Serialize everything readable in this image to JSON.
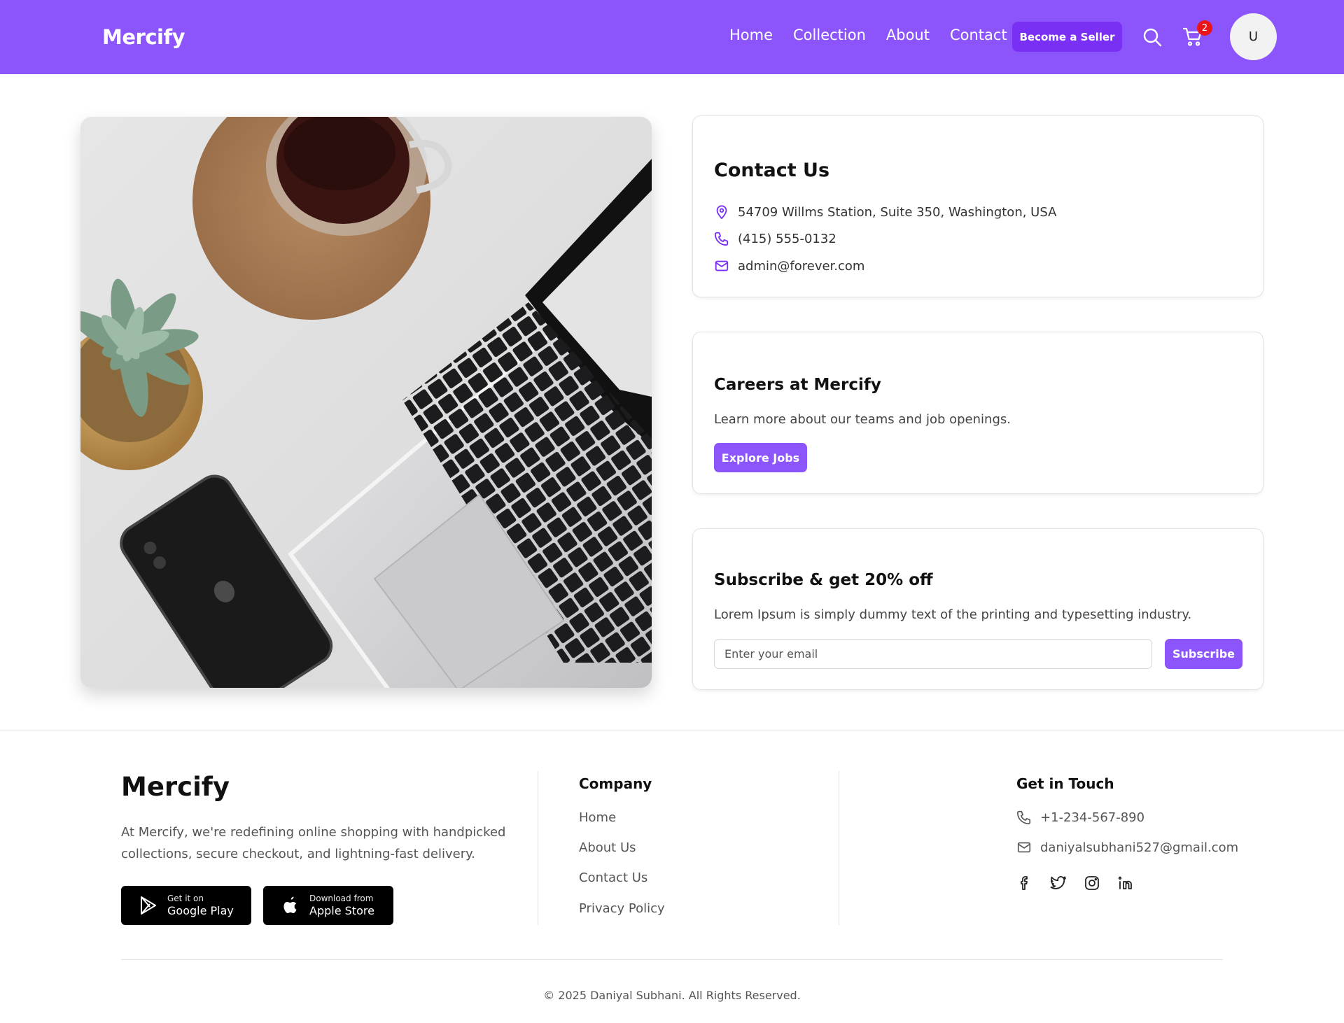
{
  "header": {
    "brand": "Mercify",
    "nav": [
      "Home",
      "Collection",
      "About",
      "Contact"
    ],
    "seller_button": "Become a Seller",
    "cart_count": "2",
    "avatar_initial": "U"
  },
  "contact": {
    "title": "Contact Us",
    "address": "54709 Willms Station, Suite 350, Washington, USA",
    "phone": "(415) 555-0132",
    "email": "admin@forever.com"
  },
  "careers": {
    "title": "Careers at Mercify",
    "description": "Learn more about our teams and job openings.",
    "button": "Explore Jobs"
  },
  "subscribe": {
    "title": "Subscribe & get 20% off",
    "description": "Lorem Ipsum is simply dummy text of the printing and typesetting industry.",
    "placeholder": "Enter your email",
    "button": "Subscribe"
  },
  "footer": {
    "brand": "Mercify",
    "description": "At Mercify, we're redefining online shopping with handpicked collections, secure checkout, and lightning-fast delivery.",
    "stores": [
      {
        "small": "Get it on",
        "big": "Google Play"
      },
      {
        "small": "Download from",
        "big": "Apple Store"
      }
    ],
    "company_title": "Company",
    "company_links": [
      "Home",
      "About Us",
      "Contact Us",
      "Privacy Policy"
    ],
    "touch_title": "Get in Touch",
    "phone": "+1-234-567-890",
    "email": "daniyalsubhani527@gmail.com",
    "social_icons": [
      "facebook-icon",
      "twitter-icon",
      "instagram-icon",
      "linkedin-icon"
    ],
    "copyright": "© 2025 Daniyal Subhani. All Rights Reserved."
  },
  "colors": {
    "brand_purple": "#8b55fb",
    "seller_button": "#7a2ff5",
    "badge_red": "#e8151b"
  }
}
